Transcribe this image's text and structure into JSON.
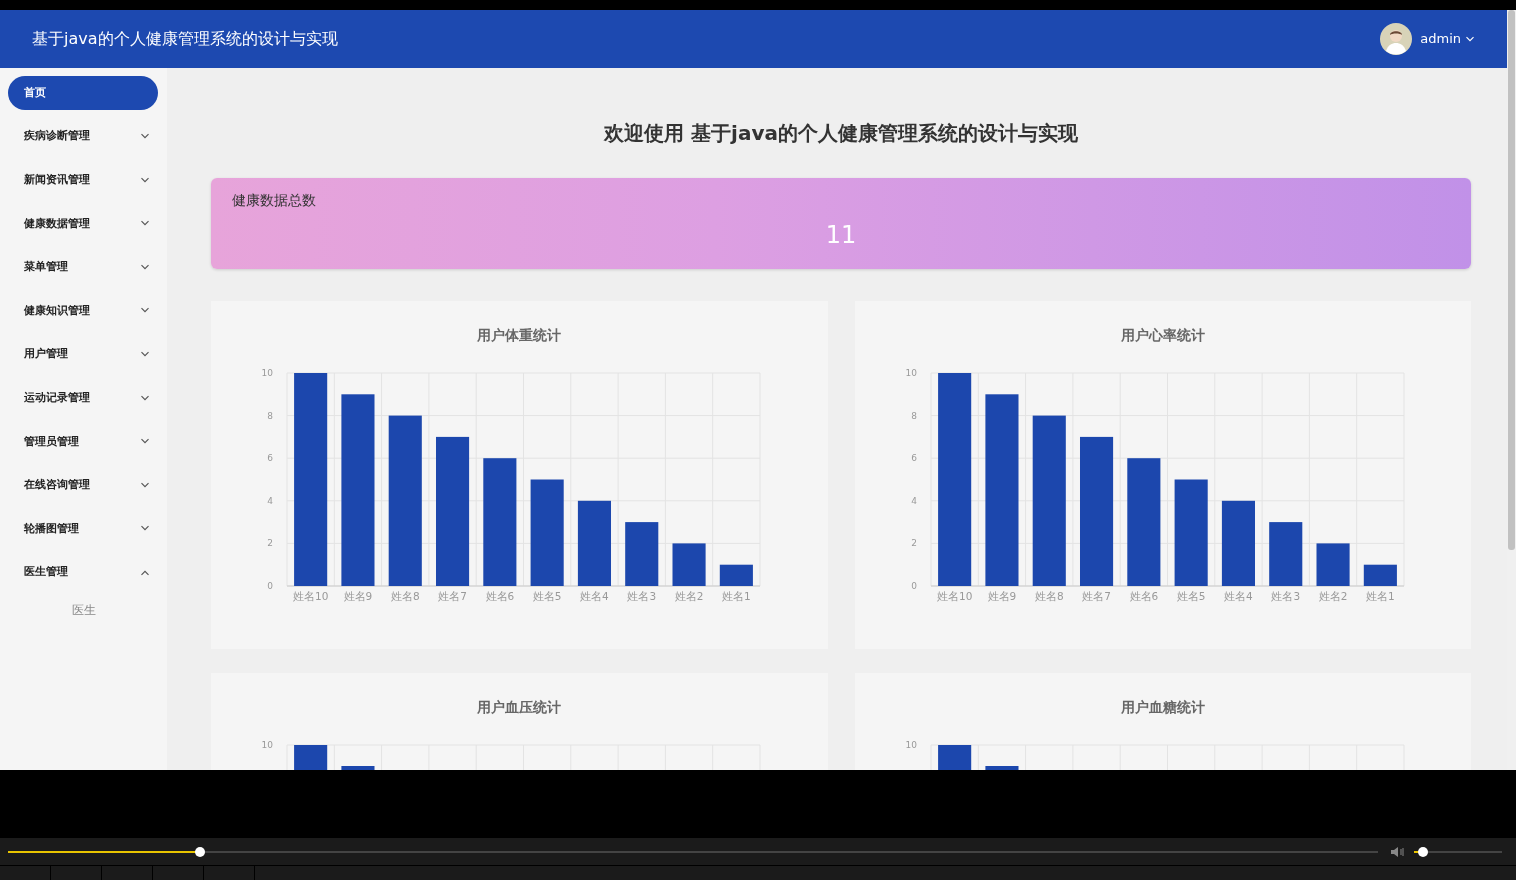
{
  "header": {
    "title": "基于java的个人健康管理系统的设计与实现",
    "user": "admin"
  },
  "sidebar": {
    "items": [
      {
        "label": "首页",
        "selected": true,
        "kind": "link"
      },
      {
        "label": "疾病诊断管理",
        "selected": false,
        "expanded": false,
        "kind": "menu"
      },
      {
        "label": "新闻资讯管理",
        "selected": false,
        "expanded": false,
        "kind": "menu"
      },
      {
        "label": "健康数据管理",
        "selected": false,
        "expanded": false,
        "kind": "menu"
      },
      {
        "label": "菜单管理",
        "selected": false,
        "expanded": false,
        "kind": "menu"
      },
      {
        "label": "健康知识管理",
        "selected": false,
        "expanded": false,
        "kind": "menu"
      },
      {
        "label": "用户管理",
        "selected": false,
        "expanded": false,
        "kind": "menu"
      },
      {
        "label": "运动记录管理",
        "selected": false,
        "expanded": false,
        "kind": "menu"
      },
      {
        "label": "管理员管理",
        "selected": false,
        "expanded": false,
        "kind": "menu"
      },
      {
        "label": "在线咨询管理",
        "selected": false,
        "expanded": false,
        "kind": "menu"
      },
      {
        "label": "轮播图管理",
        "selected": false,
        "expanded": false,
        "kind": "menu"
      },
      {
        "label": "医生管理",
        "selected": false,
        "expanded": true,
        "kind": "menu",
        "children": [
          {
            "label": "医生",
            "selected": false
          }
        ]
      }
    ]
  },
  "main": {
    "welcome": "欢迎使用 基于java的个人健康管理系统的设计与实现",
    "stat": {
      "label": "健康数据总数",
      "value": "11"
    },
    "charts": [
      {
        "chart_data": {
          "type": "bar",
          "title": "用户体重统计",
          "categories": [
            "姓名10",
            "姓名9",
            "姓名8",
            "姓名7",
            "姓名6",
            "姓名5",
            "姓名4",
            "姓名3",
            "姓名2",
            "姓名1"
          ],
          "series": [
            {
              "color": "#1c47ad",
              "values": [
                10,
                9,
                8,
                7,
                6,
                5,
                4,
                3,
                2,
                1
              ]
            }
          ],
          "ylim": [
            0,
            10
          ],
          "yticks": [
            0,
            2,
            4,
            6,
            8,
            10
          ],
          "grid": true
        }
      },
      {
        "chart_data": {
          "type": "bar",
          "title": "用户心率统计",
          "categories": [
            "姓名10",
            "姓名9",
            "姓名8",
            "姓名7",
            "姓名6",
            "姓名5",
            "姓名4",
            "姓名3",
            "姓名2",
            "姓名1"
          ],
          "series": [
            {
              "color": "#1c47ad",
              "values": [
                10,
                9,
                8,
                7,
                6,
                5,
                4,
                3,
                2,
                1
              ]
            }
          ],
          "ylim": [
            0,
            10
          ],
          "yticks": [
            0,
            2,
            4,
            6,
            8,
            10
          ],
          "grid": true
        }
      }
    ],
    "partial_charts": [
      {
        "title": "用户血压统计",
        "top_tick": "10"
      },
      {
        "title": "用户血糖统计",
        "top_tick": "10"
      }
    ]
  },
  "player": {
    "progress": {
      "level": 0.14
    },
    "volume": {
      "level": 0.1
    }
  }
}
